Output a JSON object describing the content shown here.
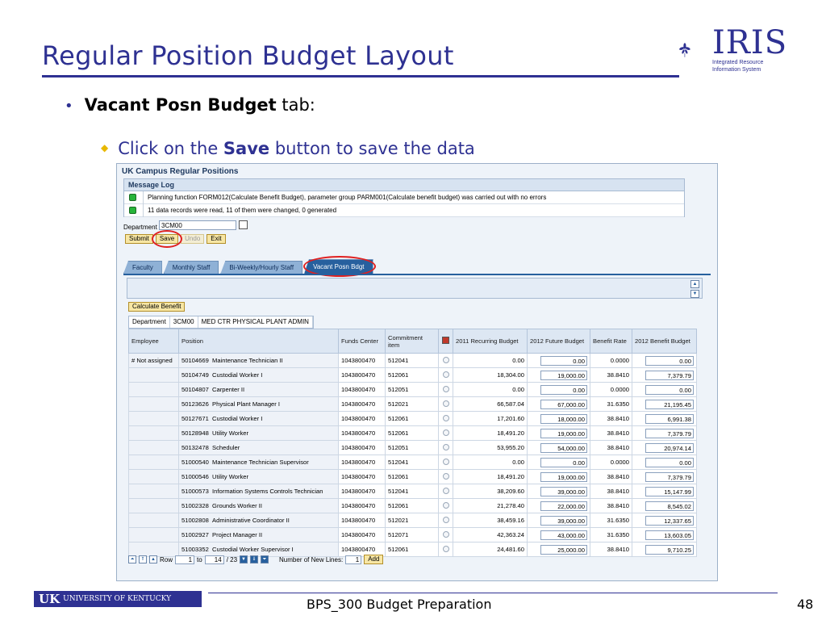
{
  "slide": {
    "title": "Regular Position Budget Layout",
    "bullet1_bold": "Vacant Posn Budget",
    "bullet1_rest": " tab:",
    "bullet2_pre": "Click on the ",
    "bullet2_bold": "Save",
    "bullet2_post": " button to save the data"
  },
  "logo": {
    "name": "IRIS",
    "line1": "Integrated Resource",
    "line2": "Information System"
  },
  "app": {
    "title": "UK Campus Regular Positions",
    "message_log_title": "Message Log",
    "messages": [
      "Planning function FORM012(Calculate Benefit Budget), parameter group PARM001(Calculate benefit budget) was carried out with no errors",
      "11 data records were read, 11 of them were changed, 0 generated"
    ],
    "department_label": "Department",
    "department_value": "3CM00",
    "buttons": {
      "submit": "Submit",
      "save": "Save",
      "undo": "Undo",
      "exit": "Exit"
    },
    "tabs": [
      "Faculty",
      "Monthly Staff",
      "Bi-Weekly/Hourly Staff",
      "Vacant Posn Bdgt"
    ],
    "calculate_benefit": "Calculate Benefit",
    "dept_bar": {
      "label": "Department",
      "code": "3CM00",
      "name": "MED CTR PHYSICAL PLANT ADMIN"
    },
    "columns": {
      "employee": "Employee",
      "position": "Position",
      "funds_center": "Funds Center",
      "commitment_item": "Commitment item",
      "recurring": "2011 Recurring Budget",
      "future_budget": "2012 Future Budget",
      "benefit_rate": "Benefit Rate",
      "benefit_budget": "2012 Benefit Budget"
    },
    "employee_marker": "#",
    "employee_value": "Not assigned",
    "rows": [
      {
        "pos": "50104669",
        "title": "Maintenance Technician II",
        "fc": "1043800470",
        "ci": "512041",
        "rec": "0.00",
        "fut": "0.00",
        "rate": "0.0000",
        "ben": "0.00"
      },
      {
        "pos": "50104749",
        "title": "Custodial Worker I",
        "fc": "1043800470",
        "ci": "512061",
        "rec": "18,304.00",
        "fut": "19,000.00",
        "rate": "38.8410",
        "ben": "7,379.79"
      },
      {
        "pos": "50104807",
        "title": "Carpenter II",
        "fc": "1043800470",
        "ci": "512051",
        "rec": "0.00",
        "fut": "0.00",
        "rate": "0.0000",
        "ben": "0.00"
      },
      {
        "pos": "50123626",
        "title": "Physical Plant Manager I",
        "fc": "1043800470",
        "ci": "512021",
        "rec": "66,587.04",
        "fut": "67,000.00",
        "rate": "31.6350",
        "ben": "21,195.45"
      },
      {
        "pos": "50127671",
        "title": "Custodial Worker I",
        "fc": "1043800470",
        "ci": "512061",
        "rec": "17,201.60",
        "fut": "18,000.00",
        "rate": "38.8410",
        "ben": "6,991.38"
      },
      {
        "pos": "50128948",
        "title": "Utility Worker",
        "fc": "1043800470",
        "ci": "512061",
        "rec": "18,491.20",
        "fut": "19,000.00",
        "rate": "38.8410",
        "ben": "7,379.79"
      },
      {
        "pos": "50132478",
        "title": "Scheduler",
        "fc": "1043800470",
        "ci": "512051",
        "rec": "53,955.20",
        "fut": "54,000.00",
        "rate": "38.8410",
        "ben": "20,974.14"
      },
      {
        "pos": "51000540",
        "title": "Maintenance Technician Supervisor",
        "fc": "1043800470",
        "ci": "512041",
        "rec": "0.00",
        "fut": "0.00",
        "rate": "0.0000",
        "ben": "0.00"
      },
      {
        "pos": "51000546",
        "title": "Utility Worker",
        "fc": "1043800470",
        "ci": "512061",
        "rec": "18,491.20",
        "fut": "19,000.00",
        "rate": "38.8410",
        "ben": "7,379.79"
      },
      {
        "pos": "51000573",
        "title": "Information Systems Controls Technician",
        "fc": "1043800470",
        "ci": "512041",
        "rec": "38,209.60",
        "fut": "39,000.00",
        "rate": "38.8410",
        "ben": "15,147.99"
      },
      {
        "pos": "51002328",
        "title": "Grounds Worker II",
        "fc": "1043800470",
        "ci": "512061",
        "rec": "21,278.40",
        "fut": "22,000.00",
        "rate": "38.8410",
        "ben": "8,545.02"
      },
      {
        "pos": "51002808",
        "title": "Administrative Coordinator II",
        "fc": "1043800470",
        "ci": "512021",
        "rec": "38,459.16",
        "fut": "39,000.00",
        "rate": "31.6350",
        "ben": "12,337.65"
      },
      {
        "pos": "51002927",
        "title": "Project Manager II",
        "fc": "1043800470",
        "ci": "512071",
        "rec": "42,363.24",
        "fut": "43,000.00",
        "rate": "31.6350",
        "ben": "13,603.05"
      },
      {
        "pos": "51003352",
        "title": "Custodial Worker Supervisor I",
        "fc": "1043800470",
        "ci": "512061",
        "rec": "24,481.60",
        "fut": "25,000.00",
        "rate": "38.8410",
        "ben": "9,710.25"
      }
    ],
    "pager": {
      "row_label": "Row",
      "row_value": "1",
      "to_label": "to",
      "to_value": "14",
      "total": "/ 23",
      "new_lines_label": "Number of New Lines:",
      "new_lines_value": "1",
      "add": "Add"
    }
  },
  "footer": {
    "university": "UNIVERSITY OF KENTUCKY",
    "uk": "UK",
    "center": "BPS_300 Budget Preparation",
    "page": "48"
  },
  "colors": {
    "title": "#2e3192",
    "highlight": "#e02020",
    "bullet_diamond": "#e8b800"
  }
}
